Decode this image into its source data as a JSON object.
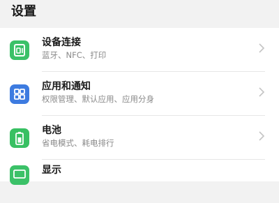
{
  "header": {
    "title": "设置"
  },
  "settings": {
    "items": [
      {
        "label": "设备连接",
        "subtitle": "蓝牙、NFC、打印",
        "icon": "device-connection-icon",
        "icon_color": "#3bc168"
      },
      {
        "label": "应用和通知",
        "subtitle": "权限管理、默认应用、应用分身",
        "icon": "apps-grid-icon",
        "icon_color": "#3d7be0"
      },
      {
        "label": "电池",
        "subtitle": "省电模式、耗电排行",
        "icon": "battery-icon",
        "icon_color": "#38c062"
      },
      {
        "label": "显示",
        "subtitle": "",
        "icon": "display-icon",
        "icon_color": "#3bc168"
      }
    ]
  }
}
